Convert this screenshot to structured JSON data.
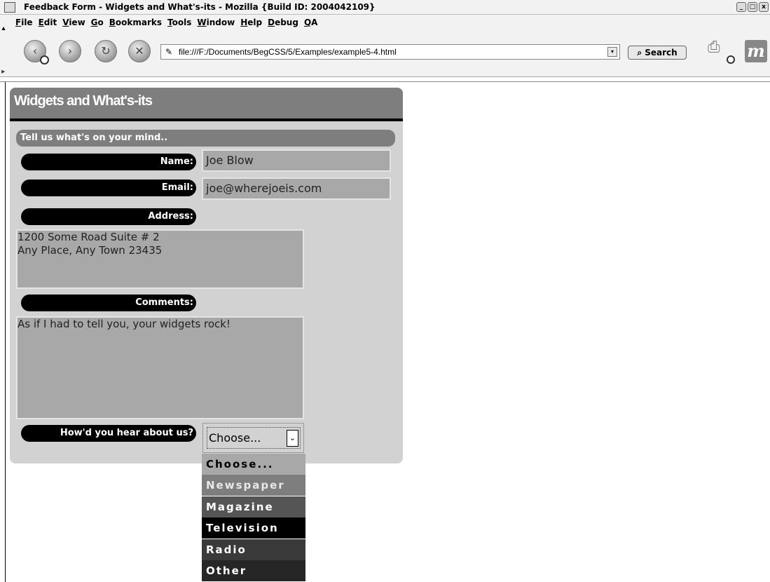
{
  "window": {
    "title": "Feedback Form - Widgets and What's-its - Mozilla {Build ID: 2004042109}",
    "controls": [
      "_",
      "□",
      "x"
    ]
  },
  "menubar": {
    "items": [
      "File",
      "Edit",
      "View",
      "Go",
      "Bookmarks",
      "Tools",
      "Window",
      "Help",
      "Debug",
      "QA"
    ]
  },
  "navigation": {
    "back_icon": "back-arrow-icon",
    "forward_icon": "forward-arrow-icon",
    "reload_icon": "reload-icon",
    "stop_icon": "stop-icon",
    "url": "file:///F:/Documents/BegCSS/5/Examples/example5-4.html",
    "search_label": "Search",
    "throbber_letter": "m"
  },
  "page": {
    "title": "Widgets and What's-its",
    "legend": "Tell us what's on your mind..",
    "fields": {
      "name_label": "Name:",
      "name_value": "Joe Blow",
      "email_label": "Email:",
      "email_value": "joe@wherejoeis.com",
      "address_label": "Address:",
      "address_line1": "1200 Some Road Suite # 2",
      "address_line2": "Any Place, Any Town 23435",
      "comments_label": "Comments:",
      "comments_value": "As if I had to tell you, your widgets rock!",
      "source_label": "How'd you hear about us?",
      "source_selected": "Choose..."
    },
    "dropdown_options": [
      {
        "label": "Choose...",
        "bg": "#a8a8a8",
        "fg": "#000000"
      },
      {
        "label": "Newspaper",
        "bg": "#7e7e7e",
        "fg": "#e8e8e8"
      },
      {
        "label": "Magazine",
        "bg": "#555555",
        "fg": "#ffffff"
      },
      {
        "label": "Television",
        "bg": "#000000",
        "fg": "#ffffff"
      },
      {
        "label": "Radio",
        "bg": "#3a3a3a",
        "fg": "#ffffff"
      },
      {
        "label": "Other",
        "bg": "#262626",
        "fg": "#ffffff"
      }
    ]
  }
}
